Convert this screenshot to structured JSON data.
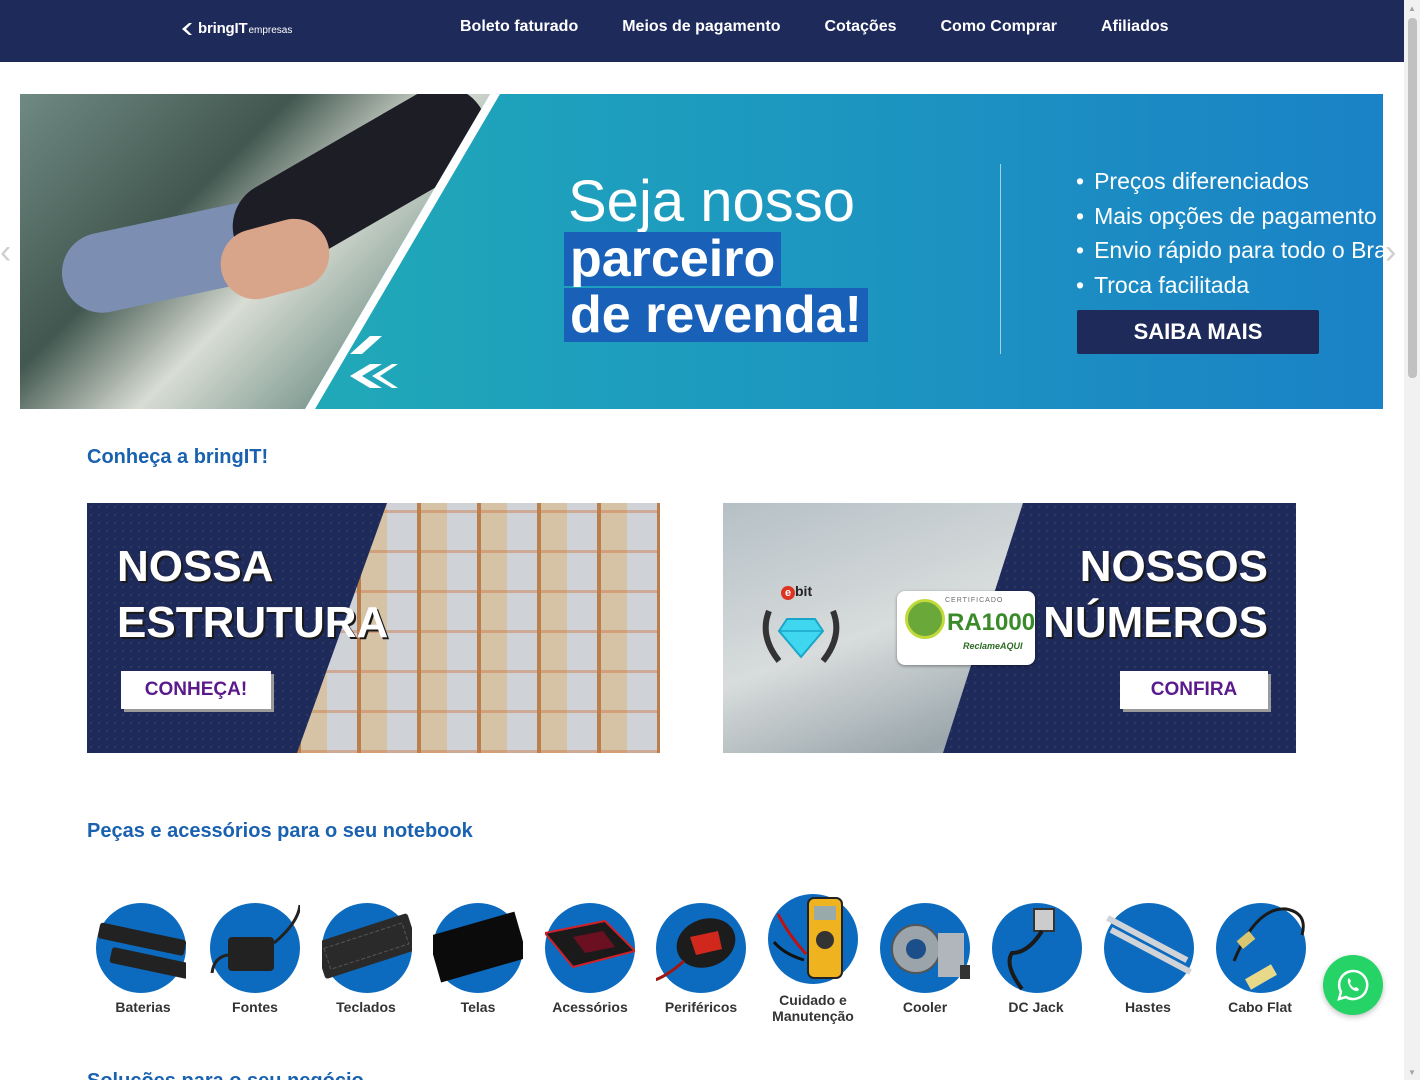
{
  "header": {
    "logo_brand": "bringIT",
    "logo_sub": "empresas",
    "nav": [
      "Boleto faturado",
      "Meios de pagamento",
      "Cotações",
      "Como Comprar",
      "Afiliados"
    ]
  },
  "hero": {
    "title_line1": "Seja nosso",
    "title_line2": "parceiro",
    "title_line3": "de revenda!",
    "bullets": [
      "Preços diferenciados",
      "Mais opções de pagamento",
      "Envio rápido para todo o Brasil",
      "Troca facilitada"
    ],
    "cta": "SAIBA MAIS",
    "prev_icon": "chevron-left-icon",
    "next_icon": "chevron-right-icon"
  },
  "about": {
    "title": "Conheça a bringIT!",
    "card_left": {
      "line1": "NOSSA",
      "line2": "ESTRUTURA",
      "button": "CONHEÇA!"
    },
    "card_right": {
      "line1": "NOSSOS",
      "line2": "NÚMEROS",
      "button": "CONFIRA",
      "ebit_label": "bit",
      "ebit_e": "e",
      "ra_cert": "CERTIFICADO",
      "ra_big": "RA1000",
      "ra_small": "ReclameAQUI"
    }
  },
  "parts": {
    "title": "Peças e acessórios para o seu notebook",
    "categories": [
      {
        "label": "Baterias"
      },
      {
        "label": "Fontes"
      },
      {
        "label": "Teclados"
      },
      {
        "label": "Telas"
      },
      {
        "label": "Acessórios"
      },
      {
        "label": "Periféricos"
      },
      {
        "label": "Cuidado e Manutenção"
      },
      {
        "label": "Cooler"
      },
      {
        "label": "DC Jack"
      },
      {
        "label": "Hastes"
      },
      {
        "label": "Cabo Flat"
      }
    ]
  },
  "solutions": {
    "title": "Soluções para o seu negócio"
  },
  "colors": {
    "navy": "#1e2a5a",
    "blue": "#1a62b0",
    "category_circle": "#0d6bbf",
    "whatsapp": "#25d366"
  }
}
